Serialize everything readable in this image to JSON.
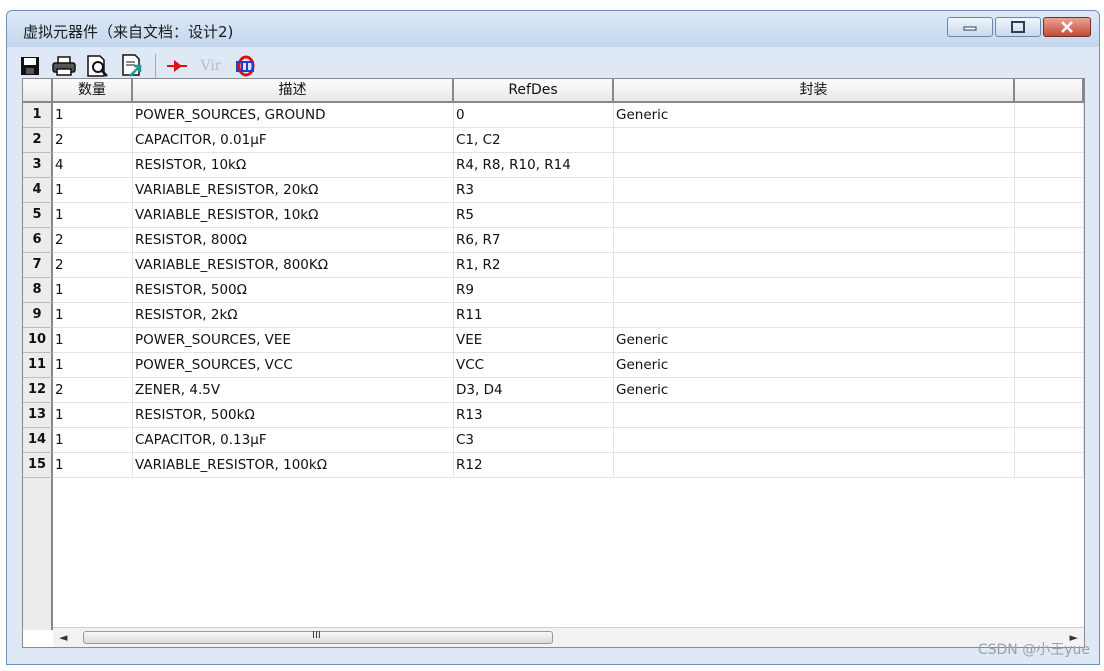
{
  "window": {
    "title": "虚拟元器件（来自文档：设计2)"
  },
  "toolbar": {
    "icons": [
      "save-icon",
      "print-icon",
      "print-preview-icon",
      "export-icon",
      "arrow-tool-icon",
      "vir-icon",
      "library-icon"
    ],
    "vir_label": "Vir"
  },
  "table": {
    "columns": [
      "数量",
      "描述",
      "RefDes",
      "封装",
      ""
    ],
    "rows": [
      {
        "n": "1",
        "qty": "1",
        "desc": "POWER_SOURCES, GROUND",
        "ref": "0",
        "pkg": "Generic"
      },
      {
        "n": "2",
        "qty": "2",
        "desc": "CAPACITOR, 0.01µF",
        "ref": "C1, C2",
        "pkg": ""
      },
      {
        "n": "3",
        "qty": "4",
        "desc": "RESISTOR, 10kΩ",
        "ref": "R4, R8, R10, R14",
        "pkg": ""
      },
      {
        "n": "4",
        "qty": "1",
        "desc": "VARIABLE_RESISTOR, 20kΩ",
        "ref": "R3",
        "pkg": ""
      },
      {
        "n": "5",
        "qty": "1",
        "desc": "VARIABLE_RESISTOR, 10kΩ",
        "ref": "R5",
        "pkg": ""
      },
      {
        "n": "6",
        "qty": "2",
        "desc": "RESISTOR, 800Ω",
        "ref": "R6, R7",
        "pkg": ""
      },
      {
        "n": "7",
        "qty": "2",
        "desc": "VARIABLE_RESISTOR, 800KΩ",
        "ref": "R1, R2",
        "pkg": ""
      },
      {
        "n": "8",
        "qty": "1",
        "desc": "RESISTOR, 500Ω",
        "ref": "R9",
        "pkg": ""
      },
      {
        "n": "9",
        "qty": "1",
        "desc": "RESISTOR, 2kΩ",
        "ref": "R11",
        "pkg": ""
      },
      {
        "n": "10",
        "qty": "1",
        "desc": "POWER_SOURCES, VEE",
        "ref": "VEE",
        "pkg": "Generic"
      },
      {
        "n": "11",
        "qty": "1",
        "desc": "POWER_SOURCES, VCC",
        "ref": "VCC",
        "pkg": "Generic"
      },
      {
        "n": "12",
        "qty": "2",
        "desc": "ZENER, 4.5V",
        "ref": "D3, D4",
        "pkg": "Generic"
      },
      {
        "n": "13",
        "qty": "1",
        "desc": "RESISTOR, 500kΩ",
        "ref": "R13",
        "pkg": ""
      },
      {
        "n": "14",
        "qty": "1",
        "desc": "CAPACITOR, 0.13µF",
        "ref": "C3",
        "pkg": ""
      },
      {
        "n": "15",
        "qty": "1",
        "desc": "VARIABLE_RESISTOR, 100kΩ",
        "ref": "R12",
        "pkg": ""
      }
    ]
  },
  "scrollbar": {
    "left_arrow": "◄",
    "grip": "III",
    "right_arrow": "►"
  },
  "watermark": "CSDN @小王yue"
}
